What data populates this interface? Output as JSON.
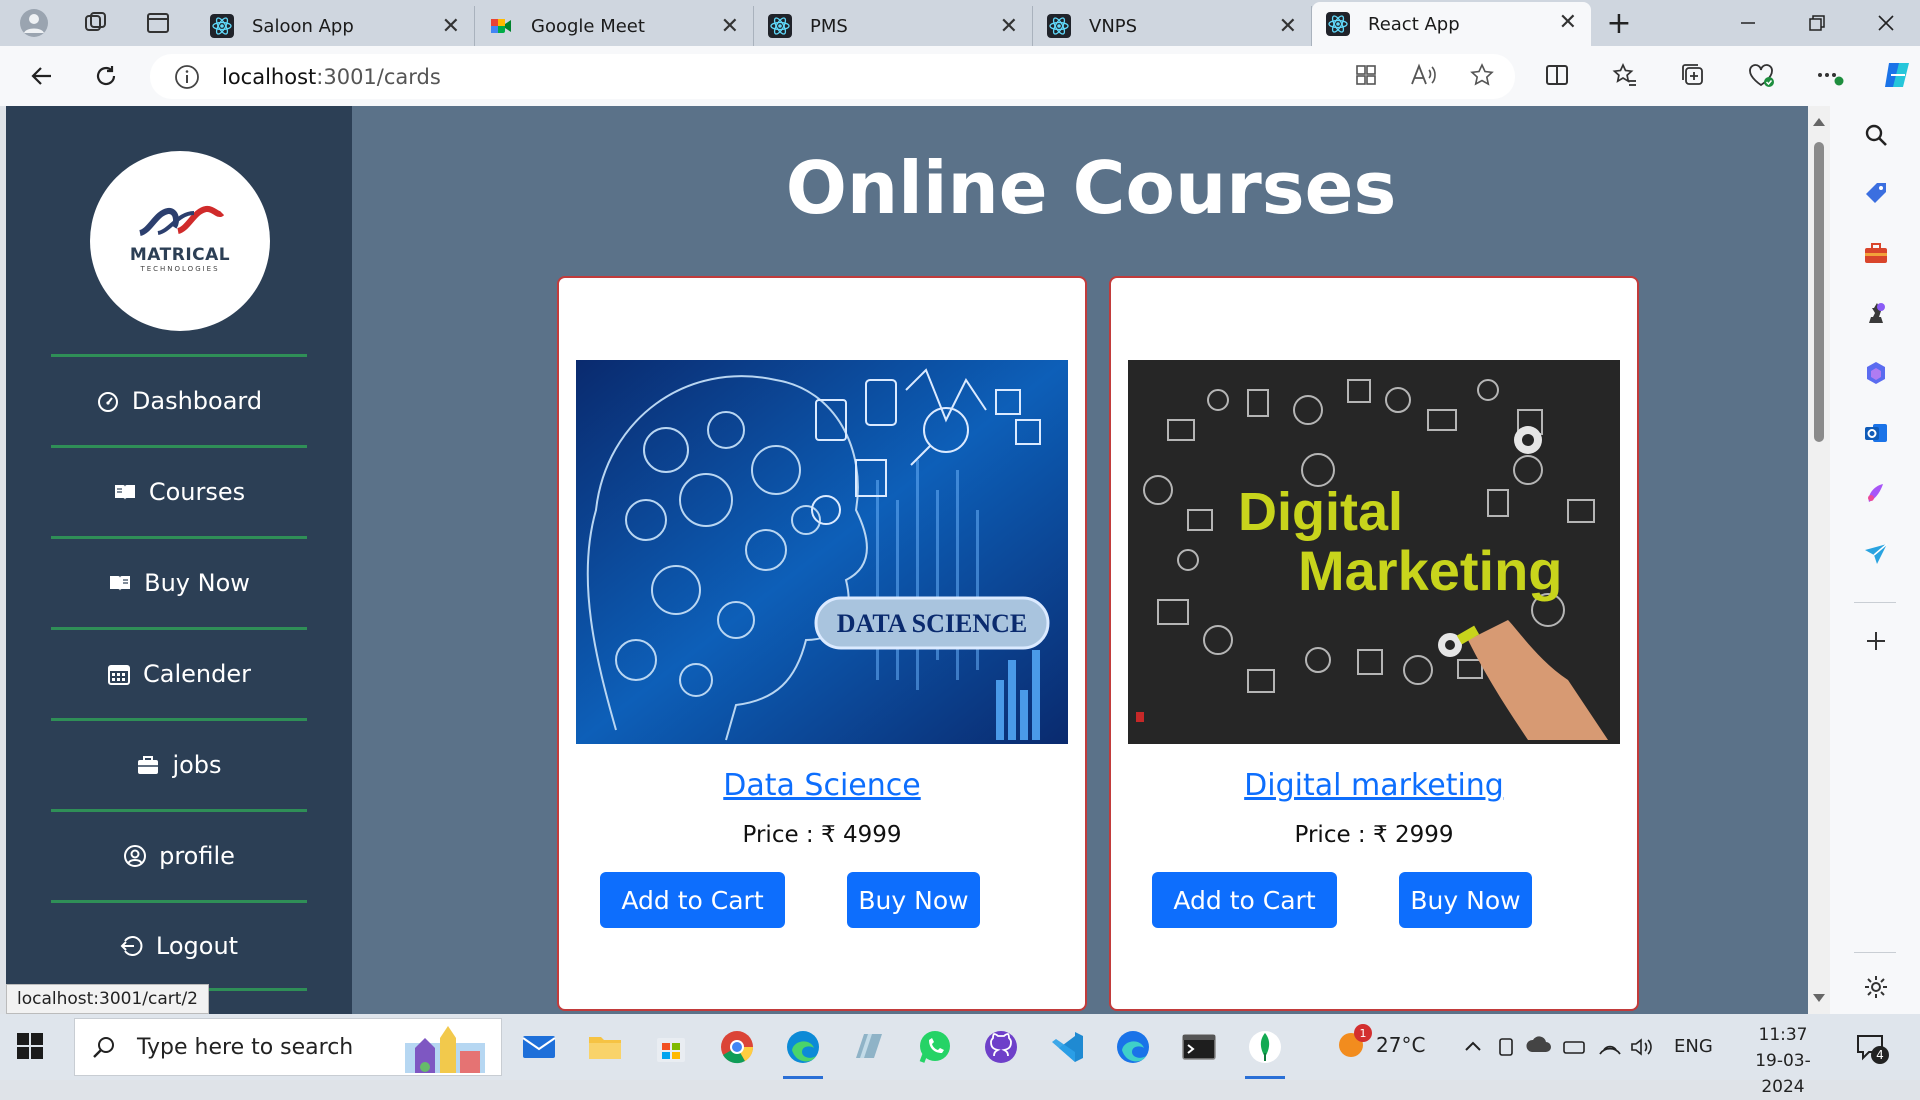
{
  "browser": {
    "tabs": [
      {
        "title": "Saloon App",
        "icon": "react-icon"
      },
      {
        "title": "Google Meet",
        "icon": "google-meet-icon"
      },
      {
        "title": "PMS",
        "icon": "react-icon"
      },
      {
        "title": "VNPS",
        "icon": "react-icon"
      },
      {
        "title": "React App",
        "icon": "react-icon",
        "active": true
      }
    ],
    "close_glyph": "✕",
    "new_tab_glyph": "+",
    "url_host": "localhost",
    "url_path": ":3001/cards",
    "status_bar_link": "localhost:3001/cart/2"
  },
  "sidebar": {
    "logo_text": "MATRICAL",
    "logo_subtext": "TECHNOLOGIES",
    "items": [
      {
        "label": "Dashboard",
        "icon": "dashboard-icon"
      },
      {
        "label": "Courses",
        "icon": "book-icon"
      },
      {
        "label": "Buy Now",
        "icon": "book-open-icon"
      },
      {
        "label": "Calender",
        "icon": "calendar-icon"
      },
      {
        "label": "jobs",
        "icon": "briefcase-icon"
      },
      {
        "label": "profile",
        "icon": "user-circle-icon"
      },
      {
        "label": "Logout",
        "icon": "logout-icon"
      }
    ]
  },
  "main": {
    "title": "Online Courses",
    "courses": [
      {
        "name": "Data Science",
        "price": "Price : ₹ 4999",
        "image_text": "DATA SCIENCE",
        "add_label": "Add to Cart",
        "buy_label": "Buy Now"
      },
      {
        "name": "Digital marketing",
        "price": "Price : ₹ 2999",
        "image_text_1": "Digital",
        "image_text_2": "Marketing",
        "add_label": "Add to Cart",
        "buy_label": "Buy Now"
      }
    ]
  },
  "taskbar": {
    "search_placeholder": "Type here to search",
    "temperature": "27°C",
    "language": "ENG",
    "time": "11:37",
    "date": "19-03-2024",
    "weather_badge": "1",
    "notification_count": "4"
  },
  "colors": {
    "page_bg": "#5b7289",
    "sidebar_bg": "#2c3f55",
    "divider": "#2f8f57",
    "primary_button": "#0d6efd",
    "card_border": "#c23b3b"
  }
}
